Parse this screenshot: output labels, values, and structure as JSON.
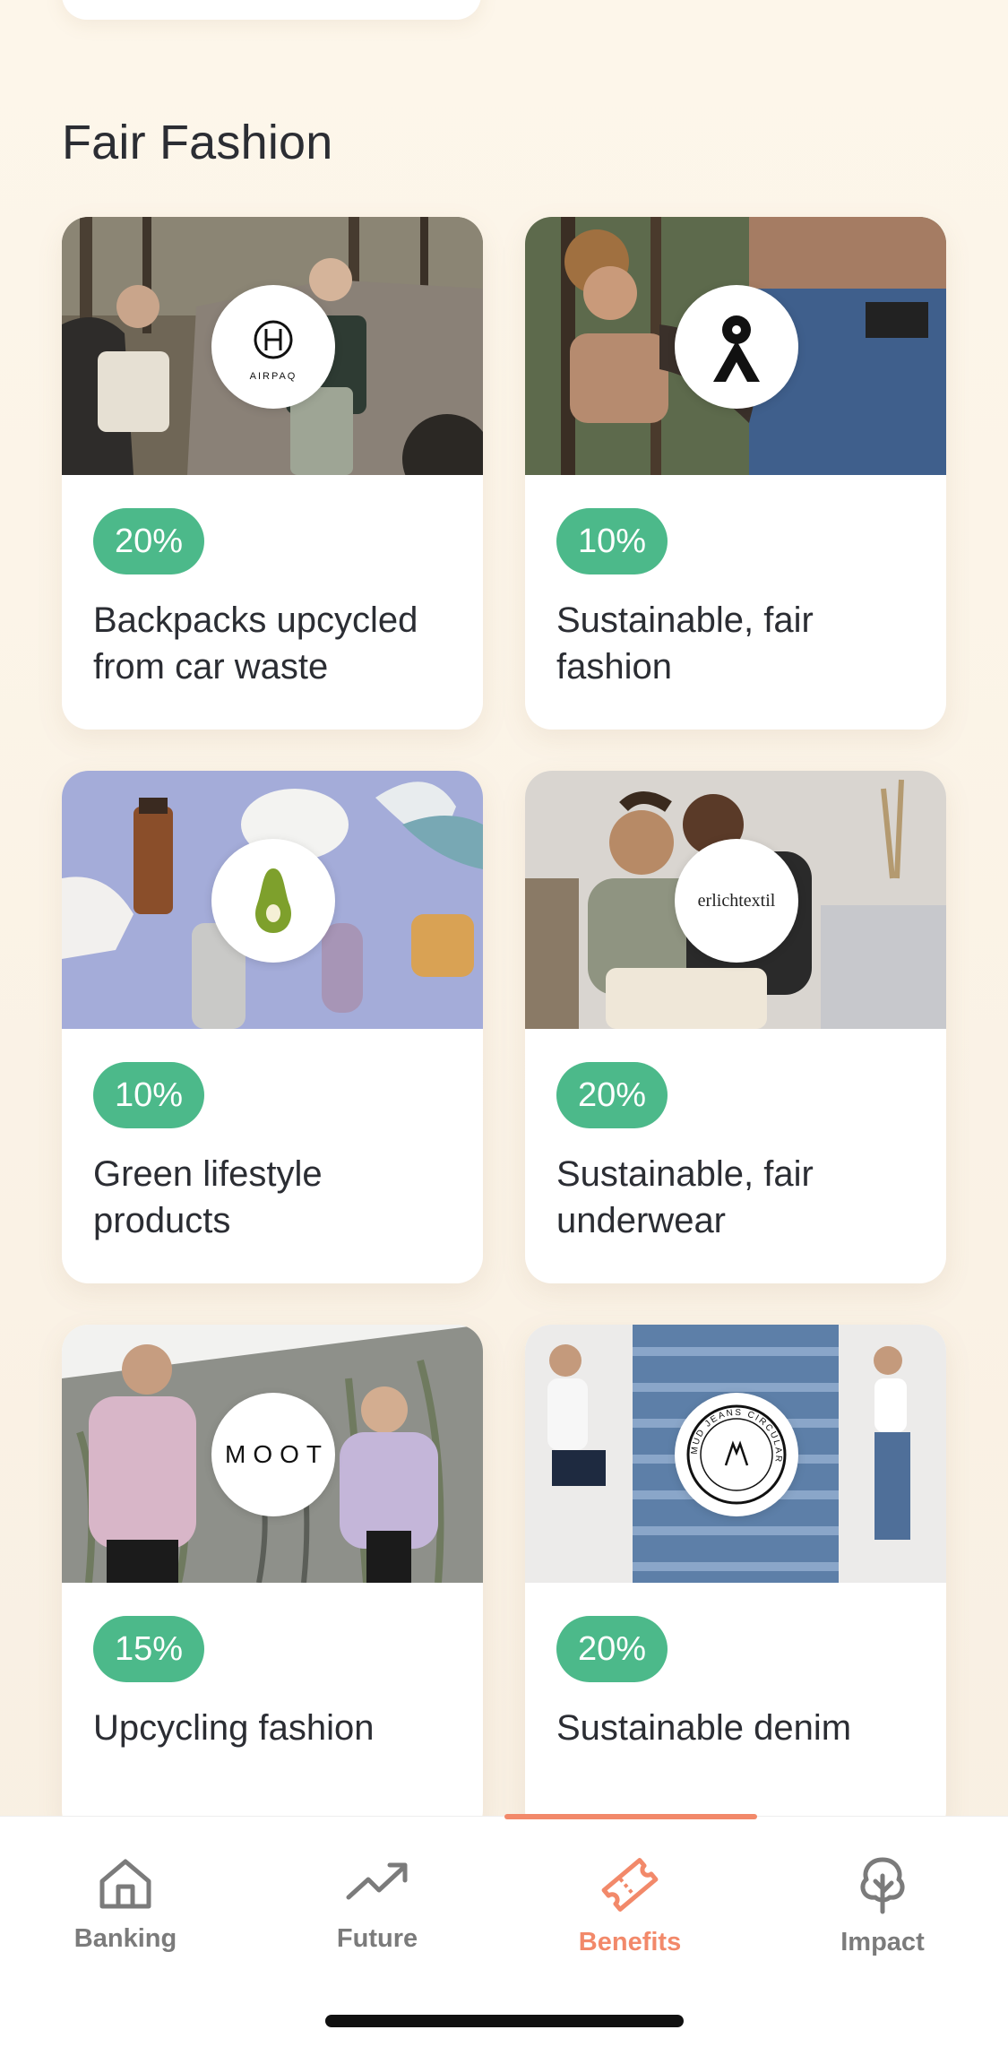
{
  "section": {
    "title": "Fair Fashion"
  },
  "cards": [
    {
      "badge": "20%",
      "description": "Backpacks upcycled from car waste",
      "logo_text": "AIRPAQ"
    },
    {
      "badge": "10%",
      "description": "Sustainable, fair fashion"
    },
    {
      "badge": "10%",
      "description": "Green lifestyle products"
    },
    {
      "badge": "20%",
      "description": "Sustainable, fair underwear",
      "logo_text": "erlichtextil"
    },
    {
      "badge": "15%",
      "description": "Upcycling fashion",
      "logo_text": "MOOT"
    },
    {
      "badge": "20%",
      "description": "Sustainable denim",
      "logo_text": "MUD JEANS CIRCULAR"
    }
  ],
  "tabbar": {
    "tabs": [
      {
        "label": "Banking",
        "icon": "home-icon"
      },
      {
        "label": "Future",
        "icon": "trend-up-icon"
      },
      {
        "label": "Benefits",
        "icon": "ticket-icon",
        "active": true
      },
      {
        "label": "Impact",
        "icon": "tree-icon"
      }
    ]
  },
  "colors": {
    "background": "#fbf3e6",
    "badge": "#4cb98a",
    "accent": "#f2896a",
    "inactive_tab": "#7b7b7b"
  }
}
